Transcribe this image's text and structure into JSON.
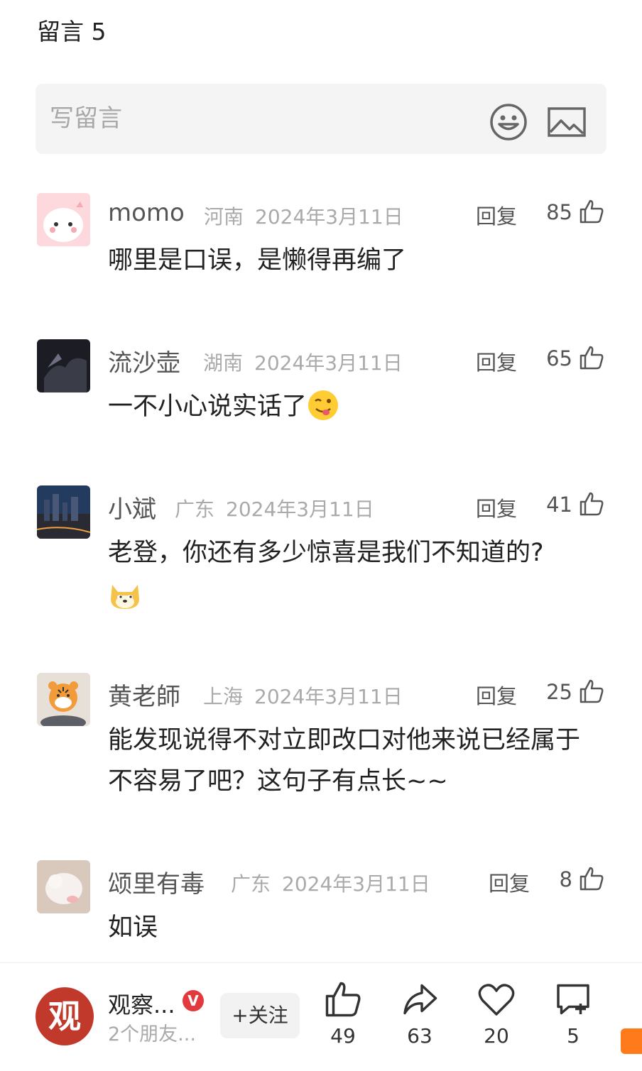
{
  "header": {
    "title": "留言 5"
  },
  "composer": {
    "placeholder": "写留言"
  },
  "comments": [
    {
      "name": "momo",
      "location": "河南",
      "date": "2024年3月11日",
      "reply": "回复",
      "likes": "85",
      "text": "哪里是口误，是懒得再编了"
    },
    {
      "name": "流沙壶",
      "location": "湖南",
      "date": "2024年3月11日",
      "reply": "回复",
      "likes": "65",
      "text": "一不小心说实话了"
    },
    {
      "name": "小斌",
      "location": "广东",
      "date": "2024年3月11日",
      "reply": "回复",
      "likes": "41",
      "text": "老登，你还有多少惊喜是我们不知道的?"
    },
    {
      "name": "黄老師",
      "location": "上海",
      "date": "2024年3月11日",
      "reply": "回复",
      "likes": "25",
      "text": "能发现说得不对立即改口对他来说已经属于不容易了吧？这句子有点长~~"
    },
    {
      "name": "颂里有毒",
      "location": "广东",
      "date": "2024年3月11日",
      "reply": "回复",
      "likes": "8",
      "text": "如误"
    }
  ],
  "bottom_bar": {
    "account_name": "观察...",
    "account_sub": "2个朋友...",
    "avatar_char": "观",
    "verified": "V",
    "follow_label": "+关注",
    "like_count": "49",
    "share_count": "63",
    "favorite_count": "20",
    "comment_count": "5"
  },
  "colors": {
    "accent_red": "#e4393c",
    "avatar_red": "#c0392b",
    "orange": "#ff7a1a"
  }
}
